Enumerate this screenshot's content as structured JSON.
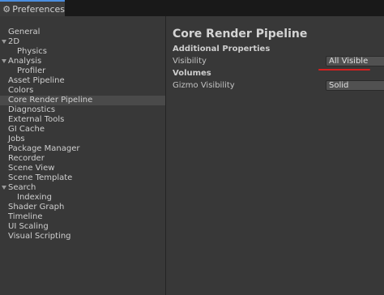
{
  "window": {
    "tab_title": "Preferences",
    "tab_icon": "gear-icon"
  },
  "sidebar": {
    "items": [
      {
        "label": "General",
        "indent": 0,
        "foldout": false
      },
      {
        "label": "2D",
        "indent": 0,
        "foldout": true
      },
      {
        "label": "Physics",
        "indent": 1,
        "foldout": false
      },
      {
        "label": "Analysis",
        "indent": 0,
        "foldout": true
      },
      {
        "label": "Profiler",
        "indent": 1,
        "foldout": false
      },
      {
        "label": "Asset Pipeline",
        "indent": 0,
        "foldout": false
      },
      {
        "label": "Colors",
        "indent": 0,
        "foldout": false
      },
      {
        "label": "Core Render Pipeline",
        "indent": 0,
        "foldout": false,
        "selected": true
      },
      {
        "label": "Diagnostics",
        "indent": 0,
        "foldout": false
      },
      {
        "label": "External Tools",
        "indent": 0,
        "foldout": false
      },
      {
        "label": "GI Cache",
        "indent": 0,
        "foldout": false
      },
      {
        "label": "Jobs",
        "indent": 0,
        "foldout": false
      },
      {
        "label": "Package Manager",
        "indent": 0,
        "foldout": false
      },
      {
        "label": "Recorder",
        "indent": 0,
        "foldout": false
      },
      {
        "label": "Scene View",
        "indent": 0,
        "foldout": false
      },
      {
        "label": "Scene Template",
        "indent": 0,
        "foldout": false
      },
      {
        "label": "Search",
        "indent": 0,
        "foldout": true
      },
      {
        "label": "Indexing",
        "indent": 1,
        "foldout": false
      },
      {
        "label": "Shader Graph",
        "indent": 0,
        "foldout": false
      },
      {
        "label": "Timeline",
        "indent": 0,
        "foldout": false
      },
      {
        "label": "UI Scaling",
        "indent": 0,
        "foldout": false
      },
      {
        "label": "Visual Scripting",
        "indent": 0,
        "foldout": false
      }
    ]
  },
  "main": {
    "title": "Core Render Pipeline",
    "additional_properties": {
      "header": "Additional Properties",
      "visibility_label": "Visibility",
      "visibility_value": "All Visible"
    },
    "volumes": {
      "header": "Volumes",
      "gizmo_label": "Gizmo Visibility",
      "gizmo_value": "Solid"
    }
  },
  "colors": {
    "accent": "#4a8ee0",
    "annotation": "#d61f1f",
    "selection": "#4a4a4a"
  }
}
